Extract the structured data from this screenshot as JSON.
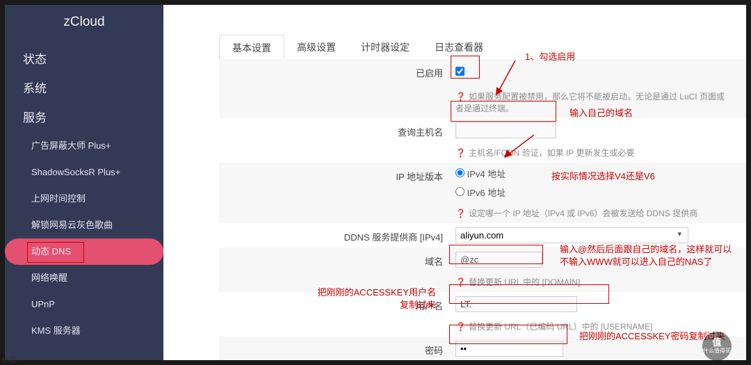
{
  "brand": "zCloud",
  "sidebar": {
    "cats": [
      "状态",
      "系统",
      "服务"
    ],
    "items": [
      {
        "label": "广告屏蔽大师 Plus+"
      },
      {
        "label": "ShadowSocksR Plus+"
      },
      {
        "label": "上网时间控制"
      },
      {
        "label": "解锁网易云灰色歌曲"
      },
      {
        "label": "动态 DNS"
      },
      {
        "label": "网络唤醒"
      },
      {
        "label": "UPnP"
      },
      {
        "label": "KMS 服务器"
      }
    ]
  },
  "tabs": [
    "基本设置",
    "高级设置",
    "计时器设定",
    "日志查看器"
  ],
  "form": {
    "enabled_label": "已启用",
    "enabled_hint": "如果服务配置被禁用，那么它将不能被启动。无论是通过 LuCI 页面或者是通过终端。",
    "lookup_label": "查询主机名",
    "lookup_value": "",
    "lookup_hint": "主机名/FQDN 验证，如果 IP 更新发生或必要",
    "ipver_label": "IP 地址版本",
    "ipv4_label": "IPv4 地址",
    "ipv6_label": "IPv6 地址",
    "ipver_hint": "设定哪一个 IP 地址（IPv4 或 IPv6）会被发送给 DDNS 提供商",
    "provider_label": "DDNS 服务提供商 [IPv4]",
    "provider_value": "aliyun.com",
    "domain_label": "域名",
    "domain_value": "@zc",
    "domain_hint": "替换更新 URL 中的 [DOMAIN]",
    "user_label": "用户名",
    "user_value": "LT.",
    "user_hint": "替换更新 URL（已编码 URL）中的 [USERNAME]",
    "pass_label": "密码",
    "pass_value": "••"
  },
  "annot": {
    "a1": "1、勾选启用",
    "a2": "输入自己的域名",
    "a3": "按实际情况选择V4还是V6",
    "a4": "输入@然后后面跟自己的域名，这样就可以不输入WWW就可以进入自己的NAS了",
    "a5": "把刚刚的ACCESSKEY用户名复制过来",
    "a6": "把刚刚的ACCESSKEY密码复制过来"
  },
  "badge": {
    "line1": "值",
    "line2": "什么值得买"
  },
  "footnote": "小包"
}
